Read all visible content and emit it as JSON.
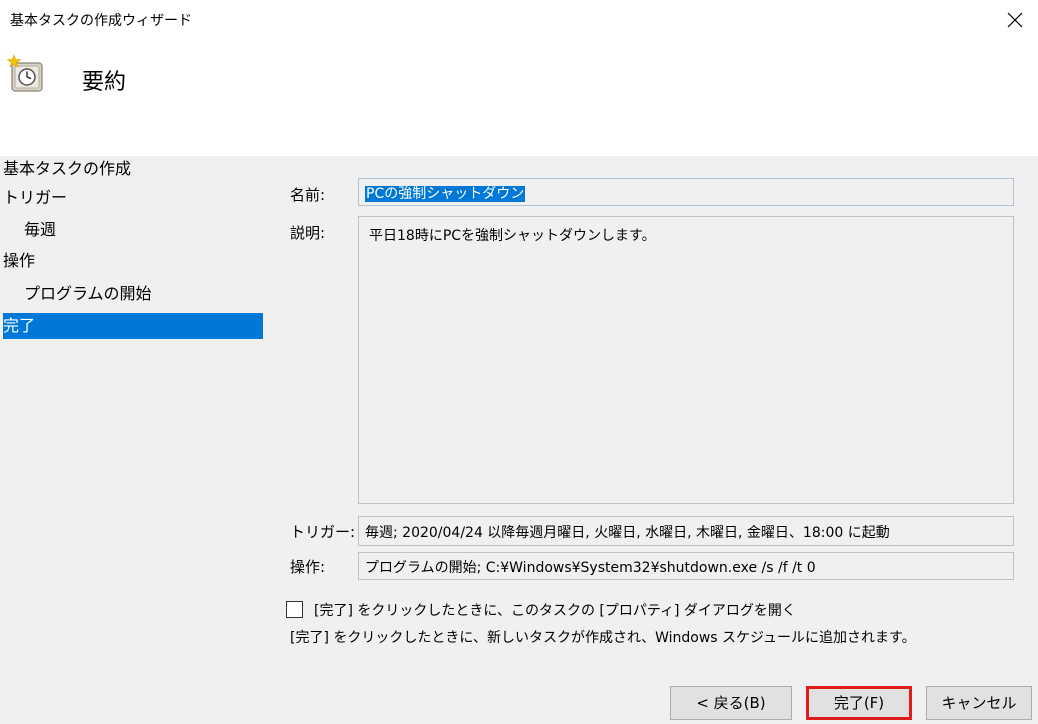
{
  "window": {
    "title": "基本タスクの作成ウィザード"
  },
  "header": {
    "icon": "task-scheduler-clock-icon",
    "title": "要約"
  },
  "steps": [
    {
      "label": "基本タスクの作成",
      "sub": false,
      "active": false
    },
    {
      "label": "トリガー",
      "sub": false,
      "active": false
    },
    {
      "label": "毎週",
      "sub": true,
      "active": false
    },
    {
      "label": "操作",
      "sub": false,
      "active": false
    },
    {
      "label": "プログラムの開始",
      "sub": true,
      "active": false
    },
    {
      "label": "完了",
      "sub": false,
      "active": true
    }
  ],
  "form": {
    "name_label": "名前:",
    "name_value": "PCの強制シャットダウン",
    "description_label": "説明:",
    "description_value": "平日18時にPCを強制シャットダウンします。",
    "trigger_label": "トリガー:",
    "trigger_value": "毎週; 2020/04/24 以降毎週月曜日, 火曜日, 水曜日, 木曜日, 金曜日、18:00 に起動",
    "action_label": "操作:",
    "action_value": "プログラムの開始; C:¥Windows¥System32¥shutdown.exe /s /f /t 0"
  },
  "open_properties": {
    "checked": false,
    "label": "[完了] をクリックしたときに、このタスクの [プロパティ] ダイアログを開く"
  },
  "note": "[完了] をクリックしたときに、新しいタスクが作成され、Windows スケジュールに追加されます。",
  "buttons": {
    "back": "< 戻る(B)",
    "finish": "完了(F)",
    "cancel": "キャンセル"
  },
  "colors": {
    "selection": "#0078d7",
    "panel_background": "#f0f0f0",
    "highlight_border": "#e01b1b"
  }
}
